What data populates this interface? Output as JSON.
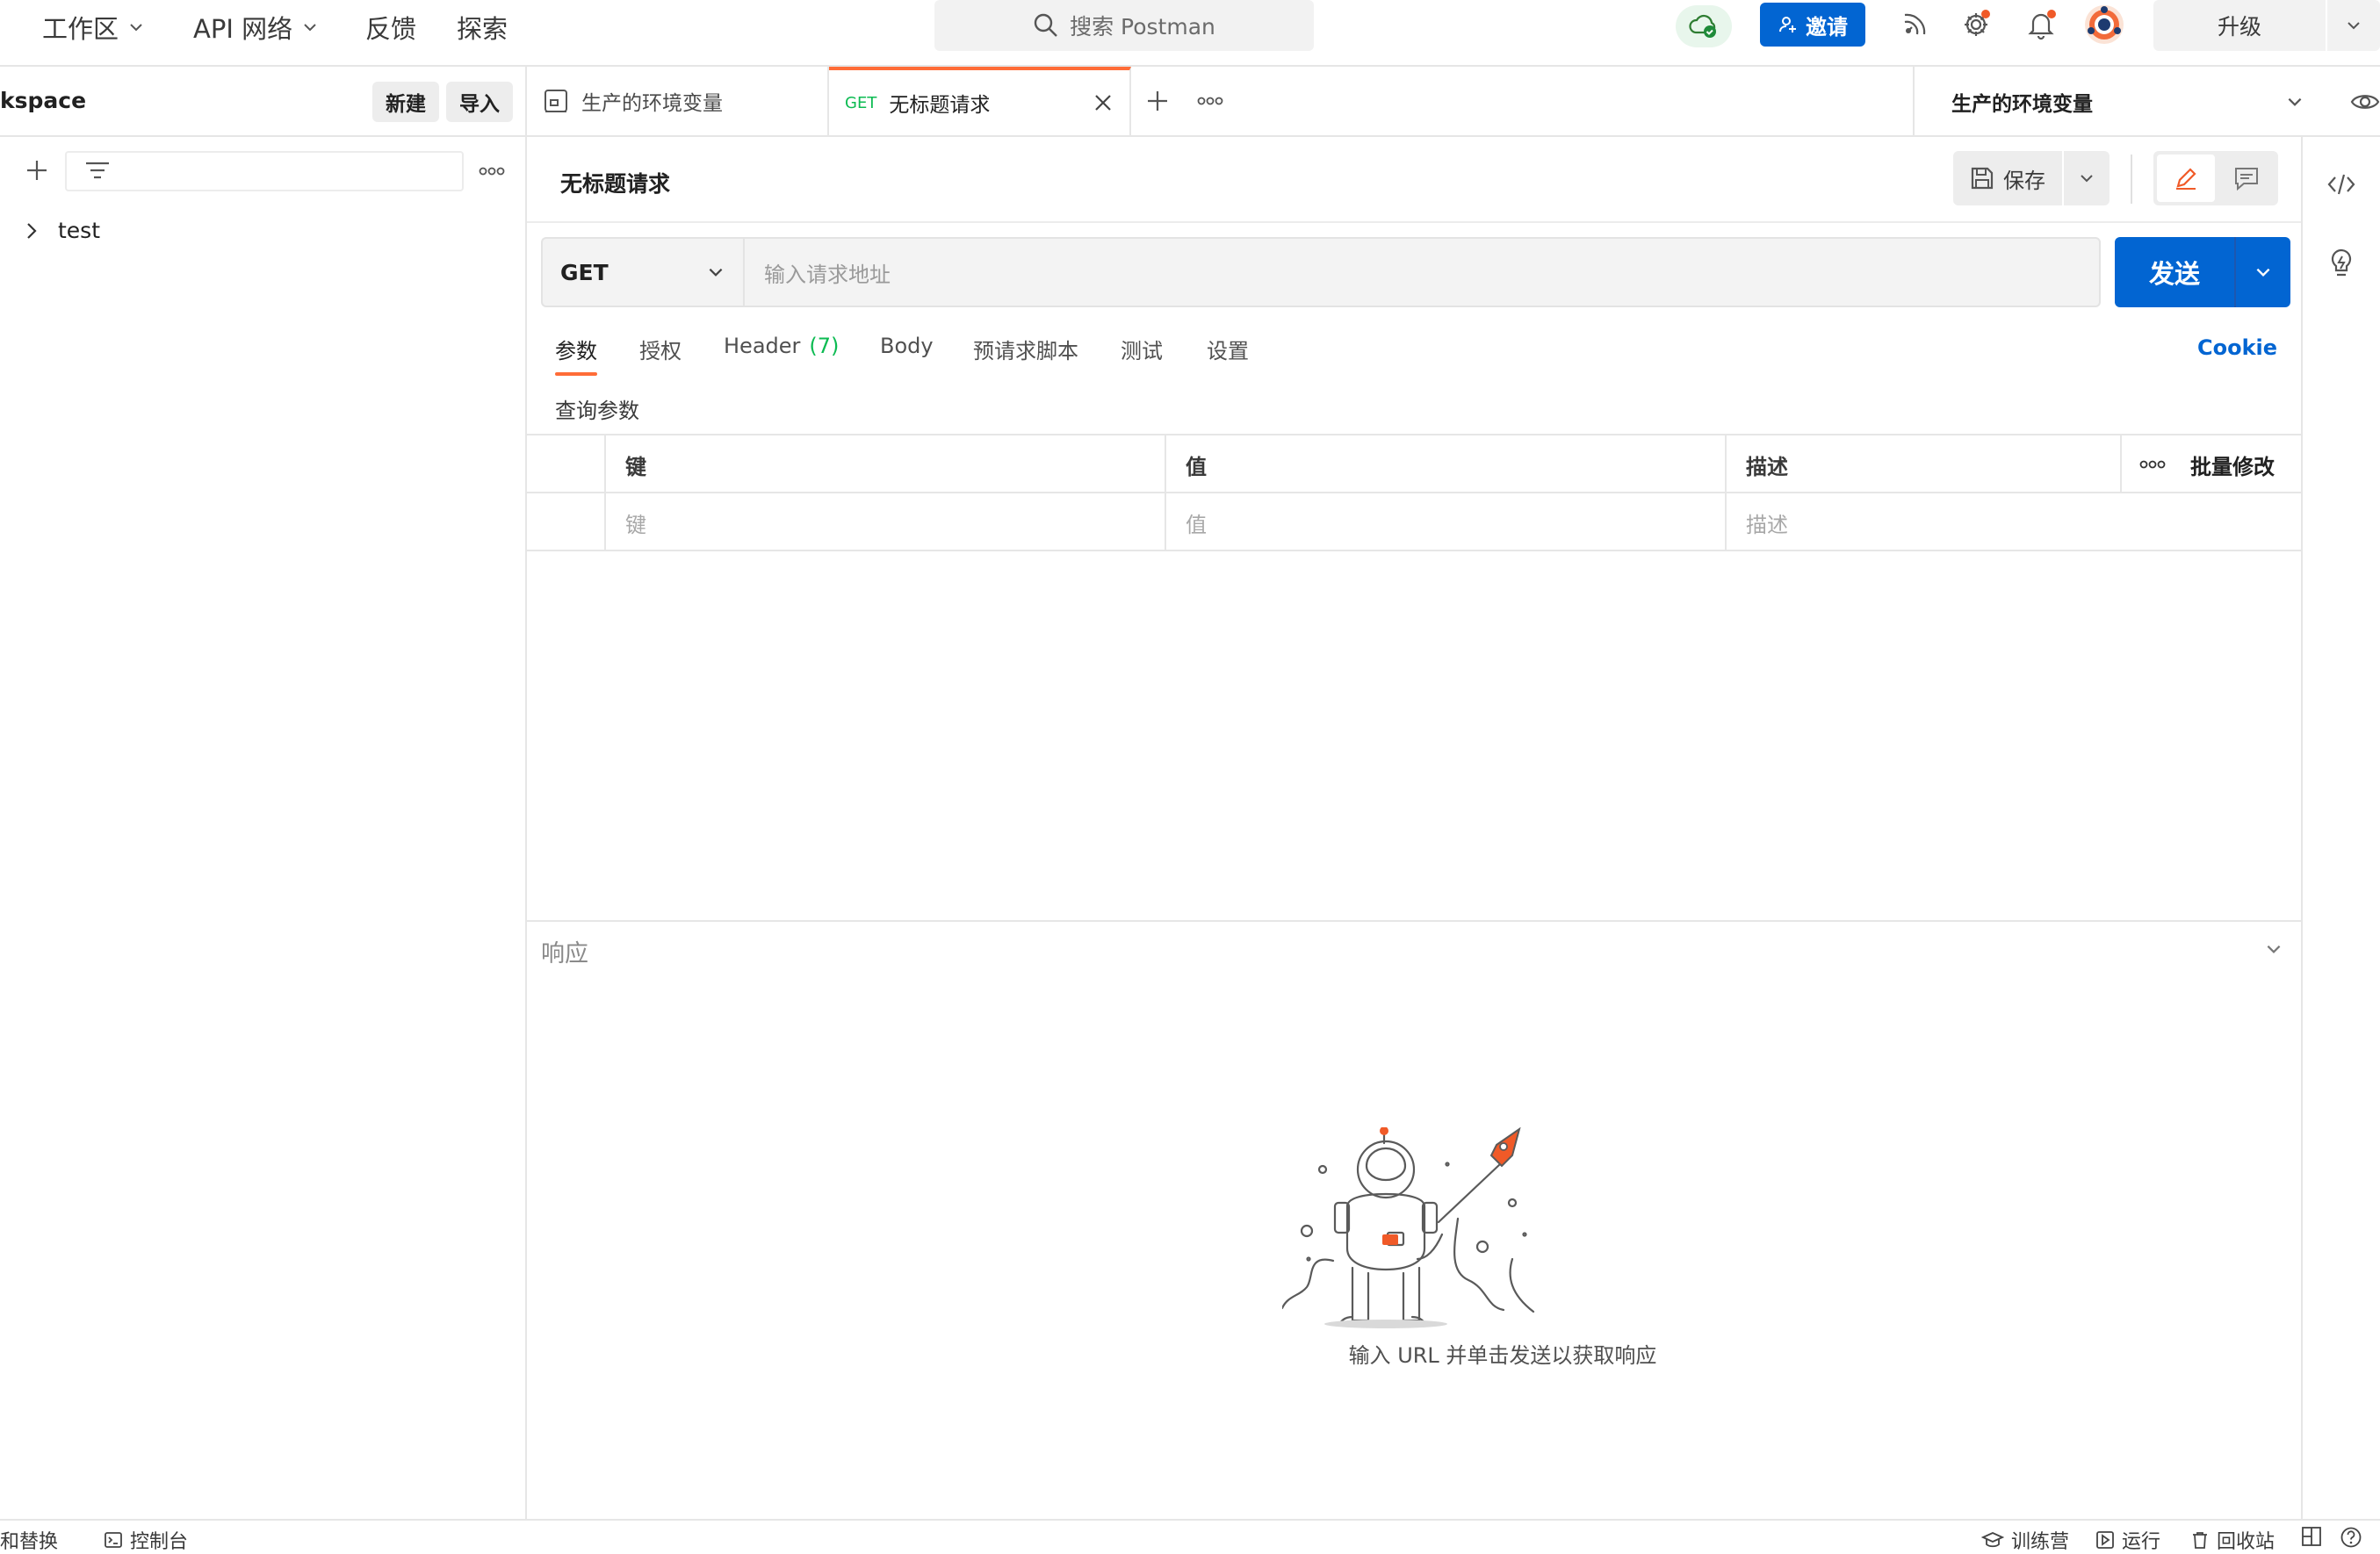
{
  "top": {
    "nav": [
      {
        "label": "工作区",
        "has_dropdown": true
      },
      {
        "label": "API 网络",
        "has_dropdown": true
      },
      {
        "label": "反馈",
        "has_dropdown": false
      },
      {
        "label": "探索",
        "has_dropdown": false
      }
    ],
    "search_placeholder": "搜索 Postman",
    "invite_label": "邀请",
    "upgrade_label": "升级",
    "icons": [
      "cloud-sync-icon",
      "invite-user-icon",
      "satellite-icon",
      "settings-icon",
      "bell-icon",
      "avatar"
    ]
  },
  "sidebar": {
    "workspace_name": "kspace",
    "new_label": "新建",
    "import_label": "导入",
    "tree": [
      {
        "label": "test",
        "expanded": false
      }
    ]
  },
  "tabs": {
    "items": [
      {
        "label": "生产的环境变量",
        "type": "environment",
        "active": false
      },
      {
        "method": "GET",
        "label": "无标题请求",
        "type": "request",
        "active": true
      }
    ],
    "environment": "生产的环境变量"
  },
  "request": {
    "title": "无标题请求",
    "save_label": "保存",
    "method": "GET",
    "url_placeholder": "输入请求地址",
    "send_label": "发送",
    "tabs": [
      {
        "label": "参数",
        "active": true
      },
      {
        "label": "授权"
      },
      {
        "label": "Header",
        "count": "(7)"
      },
      {
        "label": "Body"
      },
      {
        "label": "预请求脚本"
      },
      {
        "label": "测试"
      },
      {
        "label": "设置"
      }
    ],
    "cookie_label": "Cookie",
    "query_params_label": "查询参数",
    "table": {
      "headers": {
        "key": "键",
        "value": "值",
        "description": "描述",
        "bulk_edit": "批量修改"
      },
      "placeholders": {
        "key": "键",
        "value": "值",
        "description": "描述"
      }
    }
  },
  "response": {
    "label": "响应",
    "hint": "输入 URL 并单击发送以获取响应"
  },
  "statusbar": {
    "left": [
      {
        "label": "和替换",
        "icon": "none"
      },
      {
        "label": "控制台",
        "icon": "console-icon"
      }
    ],
    "right": [
      {
        "label": "训练营",
        "icon": "bootcamp-icon"
      },
      {
        "label": "运行",
        "icon": "runner-icon"
      },
      {
        "label": "回收站",
        "icon": "trash-icon"
      }
    ]
  },
  "colors": {
    "accent": "#ff6c37",
    "primary": "#0265d2",
    "get_method": "#0cbb52",
    "header_count": "#0cbb52"
  }
}
